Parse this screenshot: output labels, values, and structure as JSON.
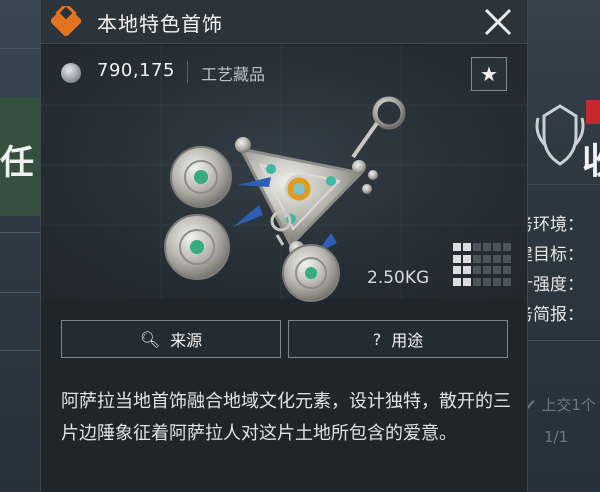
{
  "item": {
    "title": "本地特色首饰",
    "price": "790,175",
    "category": "工艺藏品",
    "weight": "2.50KG",
    "source_label": "来源",
    "usage_label": "用途",
    "description": "阿萨拉当地首饰融合地域文化元素，设计独特，散开的三片边陲象征着阿萨拉人对这片土地所包含的爱意。",
    "size_grid": {
      "cols": 6,
      "rows": 4,
      "filled_cols": 2,
      "filled_rows": 4
    },
    "icons": {
      "category": "diamond-cluster-icon",
      "currency": "silver-coin-icon",
      "favorite": "star-icon",
      "close": "close-icon",
      "source": "search-icon",
      "usage": "question-icon"
    },
    "colors": {
      "accent": "#e3731f",
      "panel": "#1e252b",
      "button_border": "#7b858e"
    }
  },
  "background": {
    "left_glyph": "任",
    "right_heading": "收",
    "right_rows": [
      "务环境：",
      "建目标：",
      "计强度：",
      "务简报："
    ],
    "footer_submit": "上交1个",
    "footer_page": "1/1"
  }
}
